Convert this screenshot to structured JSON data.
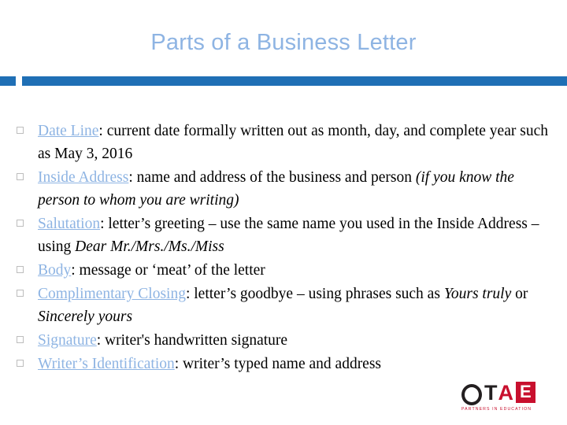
{
  "slide": {
    "title": "Parts of a Business Letter",
    "bullets": [
      {
        "term": "Date Line",
        "after_term": ":  current date formally written out as month, day, and complete year such as May 3, 2016",
        "italic_tail": ""
      },
      {
        "term": "Inside Address",
        "after_term": ": name and address of the business and person ",
        "italic_tail": "(if you know the person to whom you are writing)"
      },
      {
        "term": "Salutation",
        "after_term": ":  letter’s greeting –  use the same name you used in the Inside Address – using ",
        "italic_tail": "Dear Mr./Mrs./Ms./Miss"
      },
      {
        "term": "Body",
        "after_term": ":  message or ‘meat’ of the letter",
        "italic_tail": ""
      },
      {
        "term": "Complimentary Closing",
        "after_term": ":  letter’s goodbye – using phrases such as ",
        "italic_tail": "Yours truly",
        "after_italic": " or ",
        "italic_tail2": "Sincerely yours"
      },
      {
        "term": "Signature",
        "after_term": ":  writer's handwritten signature",
        "italic_tail": ""
      },
      {
        "term": "Writer’s Identification",
        "after_term": ":  writer’s typed name and address",
        "italic_tail": ""
      }
    ]
  },
  "logo": {
    "letter_o": "O",
    "letters_t": "T",
    "letter_a": "A",
    "letter_e": "E",
    "tagline": "PARTNERS IN EDUCATION"
  },
  "colors": {
    "title": "#8eb4e3",
    "bar": "#1f6fb5",
    "term": "#8eb4e3",
    "logo_red": "#c8102e"
  }
}
